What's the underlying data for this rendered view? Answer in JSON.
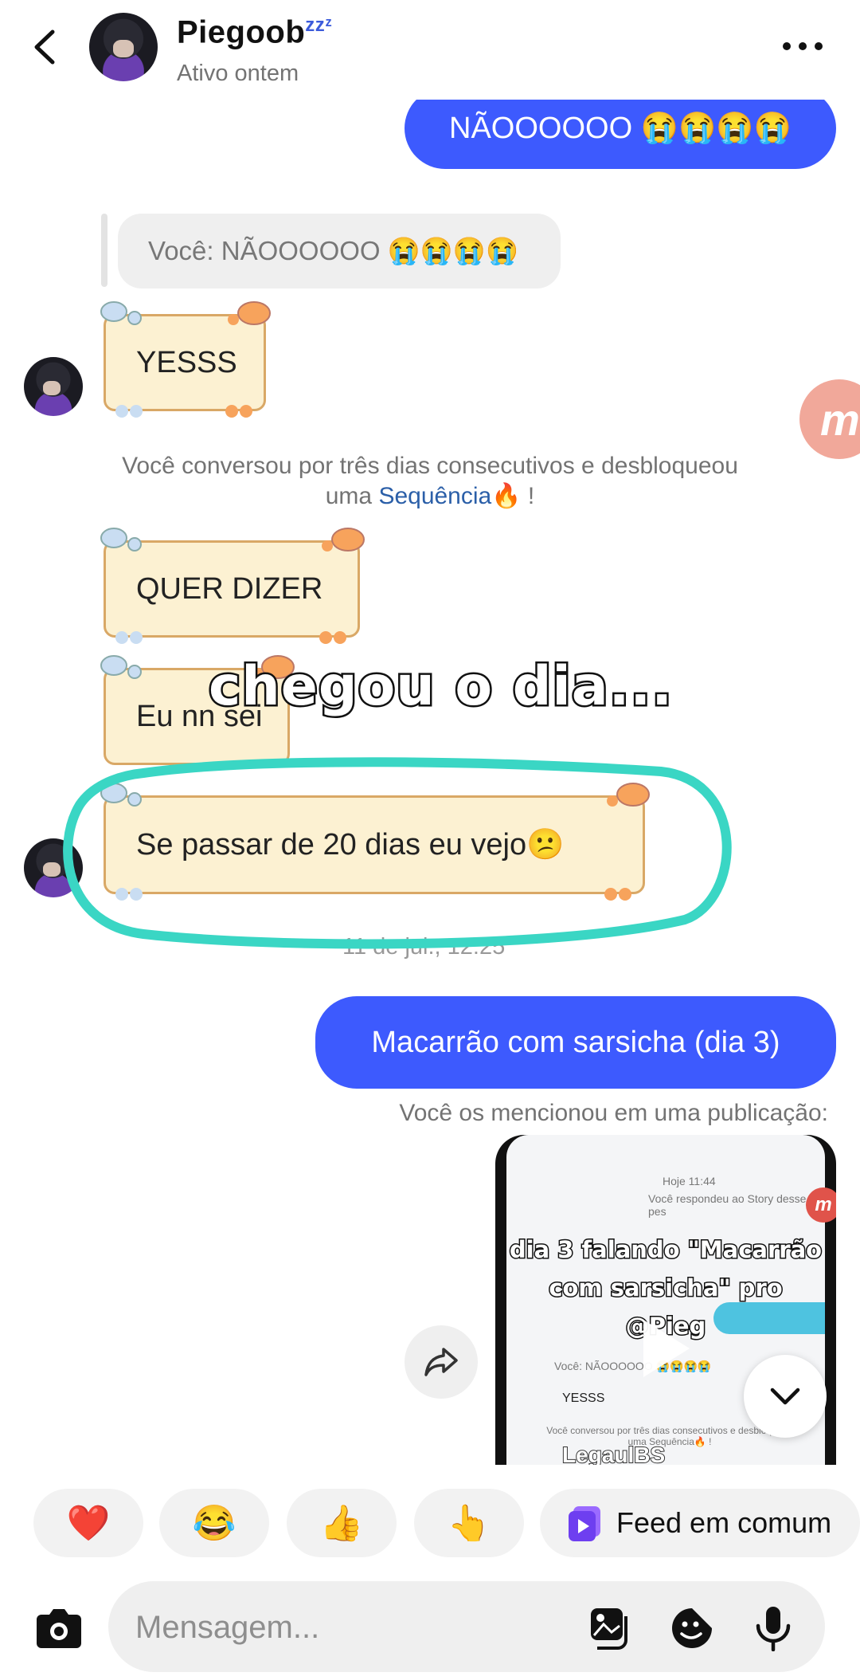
{
  "header": {
    "contact_name": "Piegoob",
    "contact_name_suffix": "zzᶻ",
    "status": "Ativo ontem",
    "icons": [
      "back-arrow-icon",
      "more-options-icon"
    ]
  },
  "messages": {
    "sent_1": "NÃOOOOOO 😭😭😭😭",
    "reply_quote": "Você: NÃOOOOOO 😭😭😭😭",
    "received_1": "YESSS",
    "system_streak_text": "Você conversou por três dias consecutivos e desbloqueou uma",
    "system_streak_link": "Sequência",
    "system_streak_end": "🔥 !",
    "received_2": "QUER DIZER",
    "received_3": "Eu nn sei",
    "received_4": "Se passar de 20 dias eu vejo😕",
    "timestamp": "11 de jul., 12:25",
    "sent_2": "Macarrão com sarsicha (dia 3)",
    "mention_note": "Você os mencionou em uma publicação:"
  },
  "overlay": {
    "title": "chegou o dia..."
  },
  "video_preview": {
    "caption_line1": "dia 3 falando \"Macarrão",
    "caption_line2": "com sarsicha\" pro",
    "caption_line3": "@Pieg",
    "mini_time": "Hoje 11:44",
    "mini_story": "Você respondeu ao Story desse pes",
    "mini_reply": "Você: NÃOOOOOO 😭😭😭😭",
    "mini_yes": "YESSS",
    "mini_streak": "Você conversou por três dias consecutivos e desbloqueou uma Sequência🔥 !",
    "mini_name": "LegaulBS"
  },
  "side_badge": "m",
  "reactions": [
    {
      "emoji": "❤️",
      "name": "heart"
    },
    {
      "emoji": "😂",
      "name": "laughing"
    },
    {
      "emoji": "👍",
      "name": "thumbs-up"
    },
    {
      "emoji": "👆",
      "name": "point-up"
    }
  ],
  "feed_chip": {
    "label": "Feed em comum"
  },
  "composer": {
    "placeholder": "Mensagem..."
  },
  "colors": {
    "accent": "#3d5afe",
    "sticker_bg": "#fcf1d2",
    "sticker_border": "#d9a866",
    "highlight": "#3ad6c4"
  }
}
